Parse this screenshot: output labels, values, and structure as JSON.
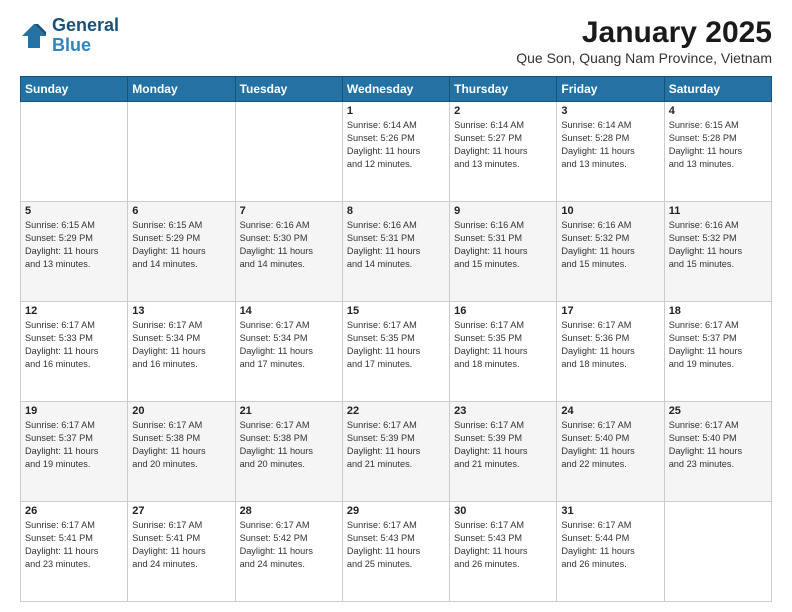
{
  "header": {
    "logo_line1": "General",
    "logo_line2": "Blue",
    "title": "January 2025",
    "subtitle": "Que Son, Quang Nam Province, Vietnam"
  },
  "weekdays": [
    "Sunday",
    "Monday",
    "Tuesday",
    "Wednesday",
    "Thursday",
    "Friday",
    "Saturday"
  ],
  "weeks": [
    [
      {
        "day": "",
        "info": ""
      },
      {
        "day": "",
        "info": ""
      },
      {
        "day": "",
        "info": ""
      },
      {
        "day": "1",
        "info": "Sunrise: 6:14 AM\nSunset: 5:26 PM\nDaylight: 11 hours\nand 12 minutes."
      },
      {
        "day": "2",
        "info": "Sunrise: 6:14 AM\nSunset: 5:27 PM\nDaylight: 11 hours\nand 13 minutes."
      },
      {
        "day": "3",
        "info": "Sunrise: 6:14 AM\nSunset: 5:28 PM\nDaylight: 11 hours\nand 13 minutes."
      },
      {
        "day": "4",
        "info": "Sunrise: 6:15 AM\nSunset: 5:28 PM\nDaylight: 11 hours\nand 13 minutes."
      }
    ],
    [
      {
        "day": "5",
        "info": "Sunrise: 6:15 AM\nSunset: 5:29 PM\nDaylight: 11 hours\nand 13 minutes."
      },
      {
        "day": "6",
        "info": "Sunrise: 6:15 AM\nSunset: 5:29 PM\nDaylight: 11 hours\nand 14 minutes."
      },
      {
        "day": "7",
        "info": "Sunrise: 6:16 AM\nSunset: 5:30 PM\nDaylight: 11 hours\nand 14 minutes."
      },
      {
        "day": "8",
        "info": "Sunrise: 6:16 AM\nSunset: 5:31 PM\nDaylight: 11 hours\nand 14 minutes."
      },
      {
        "day": "9",
        "info": "Sunrise: 6:16 AM\nSunset: 5:31 PM\nDaylight: 11 hours\nand 15 minutes."
      },
      {
        "day": "10",
        "info": "Sunrise: 6:16 AM\nSunset: 5:32 PM\nDaylight: 11 hours\nand 15 minutes."
      },
      {
        "day": "11",
        "info": "Sunrise: 6:16 AM\nSunset: 5:32 PM\nDaylight: 11 hours\nand 15 minutes."
      }
    ],
    [
      {
        "day": "12",
        "info": "Sunrise: 6:17 AM\nSunset: 5:33 PM\nDaylight: 11 hours\nand 16 minutes."
      },
      {
        "day": "13",
        "info": "Sunrise: 6:17 AM\nSunset: 5:34 PM\nDaylight: 11 hours\nand 16 minutes."
      },
      {
        "day": "14",
        "info": "Sunrise: 6:17 AM\nSunset: 5:34 PM\nDaylight: 11 hours\nand 17 minutes."
      },
      {
        "day": "15",
        "info": "Sunrise: 6:17 AM\nSunset: 5:35 PM\nDaylight: 11 hours\nand 17 minutes."
      },
      {
        "day": "16",
        "info": "Sunrise: 6:17 AM\nSunset: 5:35 PM\nDaylight: 11 hours\nand 18 minutes."
      },
      {
        "day": "17",
        "info": "Sunrise: 6:17 AM\nSunset: 5:36 PM\nDaylight: 11 hours\nand 18 minutes."
      },
      {
        "day": "18",
        "info": "Sunrise: 6:17 AM\nSunset: 5:37 PM\nDaylight: 11 hours\nand 19 minutes."
      }
    ],
    [
      {
        "day": "19",
        "info": "Sunrise: 6:17 AM\nSunset: 5:37 PM\nDaylight: 11 hours\nand 19 minutes."
      },
      {
        "day": "20",
        "info": "Sunrise: 6:17 AM\nSunset: 5:38 PM\nDaylight: 11 hours\nand 20 minutes."
      },
      {
        "day": "21",
        "info": "Sunrise: 6:17 AM\nSunset: 5:38 PM\nDaylight: 11 hours\nand 20 minutes."
      },
      {
        "day": "22",
        "info": "Sunrise: 6:17 AM\nSunset: 5:39 PM\nDaylight: 11 hours\nand 21 minutes."
      },
      {
        "day": "23",
        "info": "Sunrise: 6:17 AM\nSunset: 5:39 PM\nDaylight: 11 hours\nand 21 minutes."
      },
      {
        "day": "24",
        "info": "Sunrise: 6:17 AM\nSunset: 5:40 PM\nDaylight: 11 hours\nand 22 minutes."
      },
      {
        "day": "25",
        "info": "Sunrise: 6:17 AM\nSunset: 5:40 PM\nDaylight: 11 hours\nand 23 minutes."
      }
    ],
    [
      {
        "day": "26",
        "info": "Sunrise: 6:17 AM\nSunset: 5:41 PM\nDaylight: 11 hours\nand 23 minutes."
      },
      {
        "day": "27",
        "info": "Sunrise: 6:17 AM\nSunset: 5:41 PM\nDaylight: 11 hours\nand 24 minutes."
      },
      {
        "day": "28",
        "info": "Sunrise: 6:17 AM\nSunset: 5:42 PM\nDaylight: 11 hours\nand 24 minutes."
      },
      {
        "day": "29",
        "info": "Sunrise: 6:17 AM\nSunset: 5:43 PM\nDaylight: 11 hours\nand 25 minutes."
      },
      {
        "day": "30",
        "info": "Sunrise: 6:17 AM\nSunset: 5:43 PM\nDaylight: 11 hours\nand 26 minutes."
      },
      {
        "day": "31",
        "info": "Sunrise: 6:17 AM\nSunset: 5:44 PM\nDaylight: 11 hours\nand 26 minutes."
      },
      {
        "day": "",
        "info": ""
      }
    ]
  ]
}
